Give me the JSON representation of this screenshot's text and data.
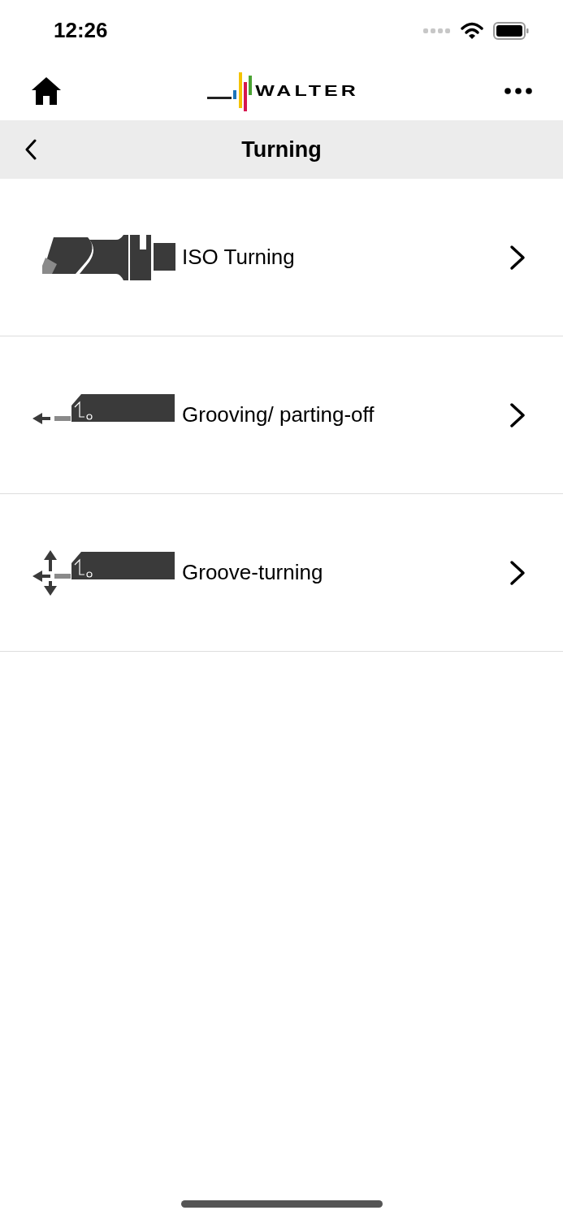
{
  "status_bar": {
    "time": "12:26"
  },
  "top_bar": {
    "logo_text": "WALTER"
  },
  "header": {
    "title": "Turning"
  },
  "items": [
    {
      "kind": "turning",
      "label": "ISO Turning"
    },
    {
      "kind": "grooving",
      "label": "Grooving/ parting-off"
    },
    {
      "kind": "groove-turning",
      "label": "Groove-turning"
    }
  ]
}
